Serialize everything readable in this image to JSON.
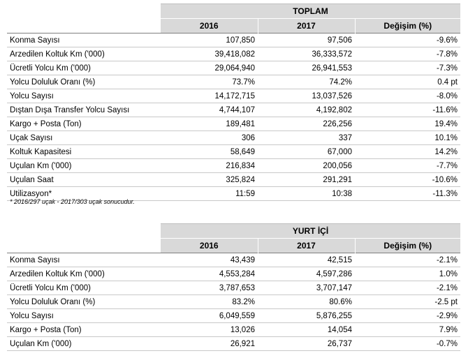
{
  "toplam": {
    "title": "TOPLAM",
    "headers": [
      "2016",
      "2017",
      "Değişim (%)"
    ],
    "rows": [
      [
        "Konma Sayısı",
        "107,850",
        "97,506",
        "-9.6%"
      ],
      [
        "Arzedilen Koltuk Km ('000)",
        "39,418,082",
        "36,333,572",
        "-7.8%"
      ],
      [
        "Ücretli Yolcu Km ('000)",
        "29,064,940",
        "26,941,553",
        "-7.3%"
      ],
      [
        "Yolcu Doluluk Oranı (%)",
        "73.7%",
        "74.2%",
        "0.4 pt"
      ],
      [
        "Yolcu Sayısı",
        "14,172,715",
        "13,037,526",
        "-8.0%"
      ],
      [
        "Dıştan Dışa Transfer Yolcu Sayısı",
        "4,744,107",
        "4,192,802",
        "-11.6%"
      ],
      [
        "Kargo + Posta (Ton)",
        "189,481",
        "226,256",
        "19.4%"
      ],
      [
        "Uçak Sayısı",
        "306",
        "337",
        "10.1%"
      ],
      [
        "Koltuk Kapasitesi",
        "58,649",
        "67,000",
        "14.2%"
      ],
      [
        "Uçulan Km ('000)",
        "216,834",
        "200,056",
        "-7.7%"
      ],
      [
        "Uçulan Saat",
        "325,824",
        "291,291",
        "-10.6%"
      ],
      [
        "Utilizasyon*",
        "11:59",
        "10:38",
        "-11.3%"
      ]
    ],
    "footnote": "* 2016/297 uçak - 2017/303 uçak sonucudur."
  },
  "yurt_ici": {
    "title": "YURT İÇİ",
    "headers": [
      "2016",
      "2017",
      "Değişim (%)"
    ],
    "rows": [
      [
        "Konma Sayısı",
        "43,439",
        "42,515",
        "-2.1%"
      ],
      [
        "Arzedilen Koltuk Km ('000)",
        "4,553,284",
        "4,597,286",
        "1.0%"
      ],
      [
        "Ücretli Yolcu Km ('000)",
        "3,787,653",
        "3,707,147",
        "-2.1%"
      ],
      [
        "Yolcu Doluluk Oranı (%)",
        "83.2%",
        "80.6%",
        "-2.5 pt"
      ],
      [
        "Yolcu Sayısı",
        "6,049,559",
        "5,876,255",
        "-2.9%"
      ],
      [
        "Kargo + Posta (Ton)",
        "13,026",
        "14,054",
        "7.9%"
      ],
      [
        "Uçulan Km ('000)",
        "26,921",
        "26,737",
        "-0.7%"
      ]
    ]
  }
}
